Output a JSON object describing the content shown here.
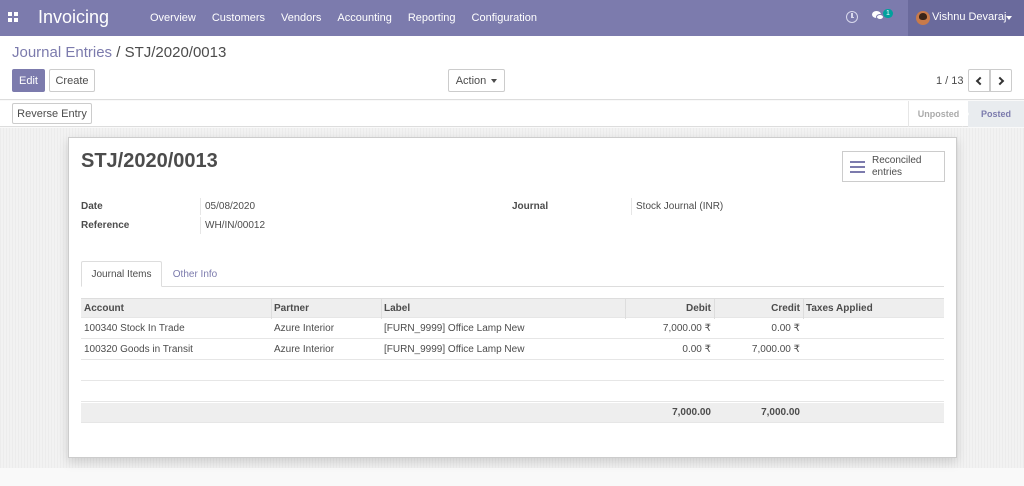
{
  "navbar": {
    "app_title": "Invoicing",
    "menu": [
      "Overview",
      "Customers",
      "Vendors",
      "Accounting",
      "Reporting",
      "Configuration"
    ],
    "chat_badge": "1",
    "user_name": "Vishnu Devaraj",
    "color": "#7c7bad"
  },
  "breadcrumb": {
    "parent": "Journal Entries",
    "separator": "/",
    "current": "STJ/2020/0013"
  },
  "buttons": {
    "edit": "Edit",
    "create": "Create",
    "action": "Action",
    "reverse": "Reverse Entry"
  },
  "pager": {
    "value": "1 / 13"
  },
  "status": {
    "unposted": "Unposted",
    "posted": "Posted",
    "current": "Posted"
  },
  "record": {
    "title": "STJ/2020/0013",
    "smart_button": "Reconciled entries",
    "date_label": "Date",
    "date_value": "05/08/2020",
    "reference_label": "Reference",
    "reference_value": "WH/IN/00012",
    "journal_label": "Journal",
    "journal_value": "Stock Journal (INR)"
  },
  "tabs": [
    "Journal Items",
    "Other Info"
  ],
  "table": {
    "headers": [
      "Account",
      "Partner",
      "Label",
      "Debit",
      "Credit",
      "Taxes Applied"
    ],
    "rows": [
      [
        "100340 Stock In Trade",
        "Azure Interior",
        "[FURN_9999] Office Lamp New",
        "7,000.00 ₹",
        "0.00 ₹",
        ""
      ],
      [
        "100320 Goods in Transit",
        "Azure Interior",
        "[FURN_9999] Office Lamp New",
        "0.00 ₹",
        "7,000.00 ₹",
        ""
      ]
    ],
    "totals": {
      "debit": "7,000.00",
      "credit": "7,000.00"
    }
  }
}
